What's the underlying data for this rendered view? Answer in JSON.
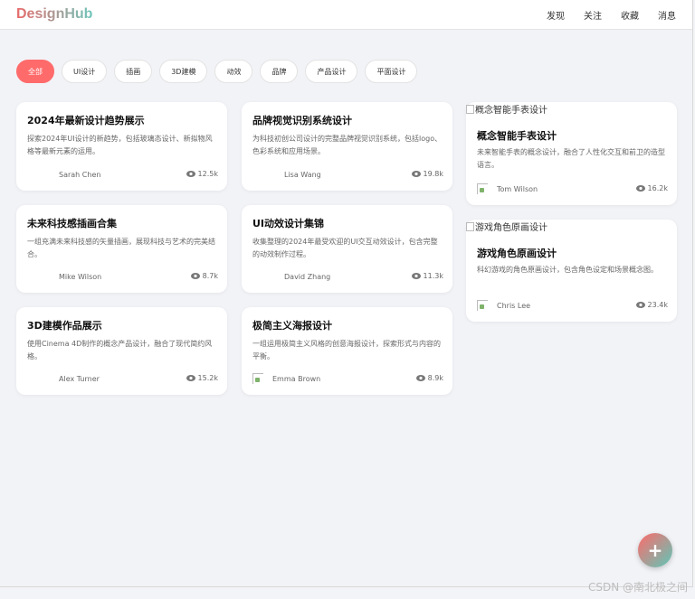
{
  "app": {
    "logo": "DesignHub"
  },
  "nav": [
    "发现",
    "关注",
    "收藏",
    "消息"
  ],
  "filters": [
    "全部",
    "UI设计",
    "插画",
    "3D建模",
    "动效",
    "品牌",
    "产品设计",
    "平面设计"
  ],
  "active_filter": "全部",
  "cards": [
    {
      "title": "2024年最新设计趋势展示",
      "desc": "探索2024年UI设计的新趋势，包括玻璃态设计、新拟物风格等最新元素的运用。",
      "author": "Sarah Chen",
      "views": "12.5k",
      "avatar": "blank"
    },
    {
      "title": "品牌视觉识别系统设计",
      "desc": "为科技初创公司设计的完整品牌视觉识别系统，包括logo、色彩系统和应用场景。",
      "author": "Lisa Wang",
      "views": "19.8k",
      "avatar": "blank"
    },
    {
      "title": "概念智能手表设计",
      "alt": "概念智能手表设计",
      "desc": "未来智能手表的概念设计，融合了人性化交互和前卫的造型语言。",
      "author": "Tom Wilson",
      "views": "16.2k",
      "avatar": "broken"
    },
    {
      "title": "未来科技感插画合集",
      "desc": "一组充满未来科技感的矢量插画，展现科技与艺术的完美结合。",
      "author": "Mike Wilson",
      "views": "8.7k",
      "avatar": "blank"
    },
    {
      "title": "UI动效设计集锦",
      "desc": "收集整理的2024年最受欢迎的UI交互动效设计，包含完整的动效制作过程。",
      "author": "David Zhang",
      "views": "11.3k",
      "avatar": "blank"
    },
    {
      "title": "游戏角色原画设计",
      "alt": "游戏角色原画设计",
      "desc": "科幻游戏的角色原画设计，包含角色设定和场景概念图。",
      "author": "Chris Lee",
      "views": "23.4k",
      "avatar": "broken"
    },
    {
      "title": "3D建模作品展示",
      "desc": "使用Cinema 4D制作的概念产品设计，融合了现代简约风格。",
      "author": "Alex Turner",
      "views": "15.2k",
      "avatar": "blank"
    },
    {
      "title": "极简主义海报设计",
      "desc": "一组运用极简主义风格的创意海报设计，探索形式与内容的平衡。",
      "author": "Emma Brown",
      "views": "8.9k",
      "avatar": "broken"
    }
  ],
  "fab": {
    "label": "+"
  },
  "watermark": "CSDN @南北极之间"
}
